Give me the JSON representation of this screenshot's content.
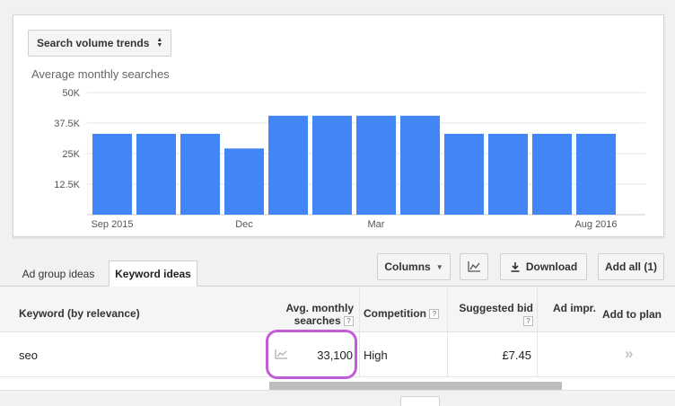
{
  "selector": {
    "label": "Search volume trends"
  },
  "chart_title": "Average monthly searches",
  "chart_data": {
    "type": "bar",
    "categories": [
      "Sep 2015",
      "Oct 2015",
      "Nov 2015",
      "Dec 2015",
      "Jan 2016",
      "Feb 2016",
      "Mar 2016",
      "Apr 2016",
      "May 2016",
      "Jun 2016",
      "Jul 2016",
      "Aug 2016"
    ],
    "values": [
      33100,
      33100,
      33100,
      27100,
      40500,
      40500,
      40500,
      40500,
      33100,
      33100,
      33100,
      33100
    ],
    "x_tick_labels": [
      "Sep 2015",
      "",
      "",
      "Dec",
      "",
      "",
      "Mar",
      "",
      "",
      "",
      "",
      "Aug 2016"
    ],
    "y_ticks": [
      12500,
      25000,
      37500,
      50000
    ],
    "y_tick_labels": [
      "12.5K",
      "25K",
      "37.5K",
      "50K"
    ],
    "ylim": [
      0,
      50000
    ],
    "bar_color": "#4285f4",
    "grid": true
  },
  "tabs": [
    {
      "label": "Ad group ideas",
      "active": false
    },
    {
      "label": "Keyword ideas",
      "active": true
    }
  ],
  "toolbar": {
    "columns_label": "Columns",
    "download_label": "Download",
    "add_all_label": "Add all (1)"
  },
  "table": {
    "headers": {
      "keyword": "Keyword (by relevance)",
      "avg_line1": "Avg. monthly",
      "avg_line2": "searches",
      "competition": "Competition",
      "bid": "Suggested bid",
      "ad_impr": "Ad impr.",
      "add_to_plan": "Add to plan"
    },
    "help_glyph": "?",
    "rows": [
      {
        "keyword": "seo",
        "avg_searches": "33,100",
        "competition": "High",
        "suggested_bid": "£7.45",
        "ad_impr": "",
        "add_glyph": "»"
      }
    ]
  }
}
